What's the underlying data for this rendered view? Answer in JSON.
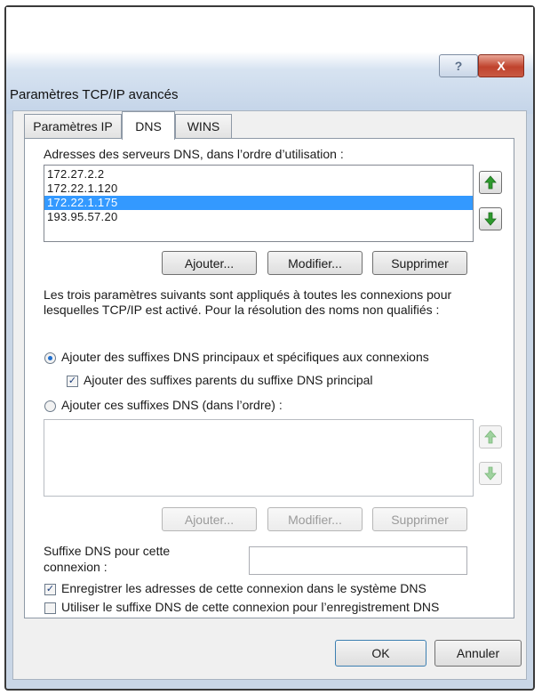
{
  "window": {
    "title": "Paramètres TCP/IP avancés",
    "help_label": "?",
    "close_label": "X"
  },
  "tabs": [
    {
      "label": "Paramètres IP",
      "active": false
    },
    {
      "label": "DNS",
      "active": true
    },
    {
      "label": "WINS",
      "active": false
    }
  ],
  "dns_servers": {
    "label": "Adresses des serveurs DNS, dans l’ordre d’utilisation :",
    "items": [
      "172.27.2.2",
      "172.22.1.120",
      "172.22.1.175",
      "193.95.57.20"
    ],
    "selected_index": 2,
    "up_icon": "green-up-arrow-icon",
    "down_icon": "green-down-arrow-icon",
    "add_label": "Ajouter...",
    "edit_label": "Modifier...",
    "remove_label": "Supprimer"
  },
  "info_text": {
    "line1": "Les trois paramètres suivants sont appliqués à toutes les connexions pour",
    "line2": "lesquelles TCP/IP est activé. Pour la résolution des noms non qualifiés :"
  },
  "suffix_options": {
    "primary_radio_label": "Ajouter des suffixes DNS principaux et spécifiques aux connexions",
    "primary_radio_checked": true,
    "parent_checkbox_label": "Ajouter des suffixes parents du suffixe DNS principal",
    "parent_checkbox_checked": true,
    "custom_radio_label": "Ajouter ces suffixes DNS (dans l’ordre) :",
    "custom_radio_checked": false,
    "add_label": "Ajouter...",
    "edit_label": "Modifier...",
    "remove_label": "Supprimer"
  },
  "connection_suffix": {
    "label_line1": "Suffixe DNS pour cette",
    "label_line2": "connexion :",
    "value": ""
  },
  "register_options": {
    "register_label": "Enregistrer les adresses de cette connexion dans le système DNS",
    "register_checked": true,
    "use_suffix_label": "Utiliser le suffixe DNS de cette connexion pour l’enregistrement DNS",
    "use_suffix_checked": false
  },
  "footer": {
    "ok_label": "OK",
    "cancel_label": "Annuler"
  },
  "colors": {
    "selection": "#3399ff",
    "arrow_green": "#2e9a2e",
    "close_red": "#c0432d"
  }
}
